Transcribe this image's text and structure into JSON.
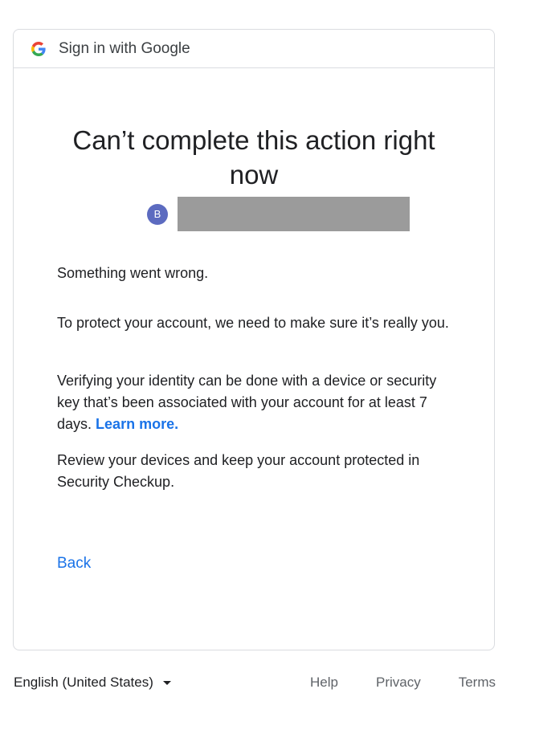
{
  "header": {
    "logo_icon": "google-g-logo-icon",
    "title": "Sign in with Google"
  },
  "main": {
    "heading": "Can’t complete this action right now",
    "account": {
      "avatar_letter": "B",
      "avatar_color": "#5c6bc0"
    },
    "paragraphs": {
      "p1": "Something went wrong.",
      "p2": "To protect your account, we need to make sure it’s really you.",
      "p3": "Verifying your identity can be done with a device or security key that’s been associated with your account for at least 7 days.",
      "p3_link": "Learn more.",
      "p4": "Review your devices and keep your account protected in Security Checkup."
    },
    "back_label": "Back"
  },
  "footer": {
    "language": "English (United States)",
    "help": "Help",
    "privacy": "Privacy",
    "terms": "Terms"
  },
  "colors": {
    "link": "#1a73e8",
    "border": "#dadce0",
    "redaction": "#9b9b9b"
  }
}
